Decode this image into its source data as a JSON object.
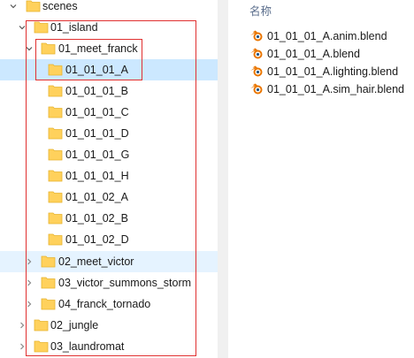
{
  "tree": {
    "items": [
      {
        "label": "scenes",
        "state": "expanded"
      },
      {
        "label": "01_island",
        "state": "expanded"
      },
      {
        "label": "01_meet_franck",
        "state": "expanded"
      },
      {
        "label": "01_01_01_A",
        "state": "selected"
      },
      {
        "label": "01_01_01_B"
      },
      {
        "label": "01_01_01_C"
      },
      {
        "label": "01_01_01_D"
      },
      {
        "label": "01_01_01_G"
      },
      {
        "label": "01_01_01_H"
      },
      {
        "label": "01_01_02_A"
      },
      {
        "label": "01_01_02_B"
      },
      {
        "label": "01_01_02_D"
      },
      {
        "label": "02_meet_victor",
        "state": "collapsed-hover"
      },
      {
        "label": "03_victor_summons_storm",
        "state": "collapsed"
      },
      {
        "label": "04_franck_tornado",
        "state": "collapsed"
      },
      {
        "label": "02_jungle",
        "state": "collapsed"
      },
      {
        "label": "03_laundromat",
        "state": "collapsed"
      }
    ]
  },
  "file_list": {
    "column_header": "名称",
    "files": [
      {
        "name": "01_01_01_A.anim.blend",
        "icon": "blender-icon"
      },
      {
        "name": "01_01_01_A.blend",
        "icon": "blender-icon"
      },
      {
        "name": "01_01_01_A.lighting.blend",
        "icon": "blender-icon"
      },
      {
        "name": "01_01_01_A.sim_hair.blend",
        "icon": "blender-icon"
      }
    ]
  },
  "colors": {
    "selection": "#cce8ff",
    "hover": "#e5f3ff",
    "folder": "#ffd15c",
    "annotation": "#e03030",
    "blender_orange": "#ea7600",
    "blender_blue": "#265787"
  }
}
